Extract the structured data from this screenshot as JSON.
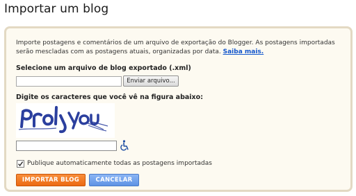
{
  "page": {
    "title": "Importar um blog"
  },
  "panel": {
    "description": "Importe postagens e comentários de um arquivo de exportação do Blogger. As postagens importadas serão mescladas com as postagens atuais, organizadas por data.",
    "learn_more_link": "Saiba mais.",
    "file_label": "Selecione um arquivo de blog exportado (.xml)",
    "file_input_value": "",
    "file_button_label": "Enviar arquivo...",
    "captcha_label": "Digite os caracteres que você vê na figura abaixo:",
    "captcha_value": "",
    "auto_publish_label": "Publique automaticamente todas as postagens importadas",
    "auto_publish_checked": true,
    "import_button_label": "IMPORTAR BLOG",
    "cancel_button_label": "CANCELAR"
  },
  "icons": {
    "audio_captcha": "wheelchair-accessibility-icon",
    "captcha_image": "captcha-image"
  },
  "colors": {
    "panel_background": "#fdfaf1",
    "panel_border": "#e3d9c3",
    "link": "#1155cc",
    "primary_button": "#ec6a12",
    "secondary_button": "#5e93e4",
    "captcha_ink": "#2b3f9e"
  }
}
